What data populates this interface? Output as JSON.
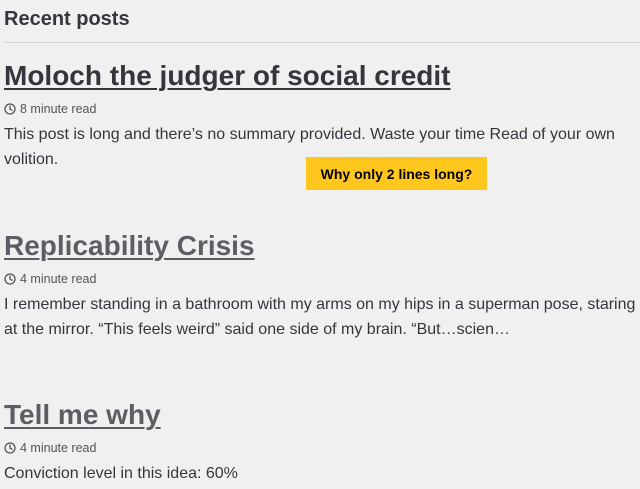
{
  "section": {
    "title": "Recent posts"
  },
  "posts": [
    {
      "title": "Moloch the judger of social credit",
      "read_time": "8 minute read",
      "excerpt": "This post is long and there’s no summary provided. Waste your time Read of your own volition."
    },
    {
      "title": "Replicability Crisis",
      "read_time": "4 minute read",
      "excerpt": "I remember standing in a bathroom with my arms on my hips in a superman pose, staring at the mirror. “This feels weird” said one side of my brain. “But…scien…"
    },
    {
      "title": "Tell me why",
      "read_time": "4 minute read",
      "excerpt": "Conviction level in this idea: 60%"
    }
  ],
  "callout": {
    "text": "Why only 2 lines long?"
  },
  "colors": {
    "background": "#f0f0f0",
    "text": "#34363d",
    "muted_link": "#5c5e64",
    "callout_bg": "#ffc61e"
  }
}
